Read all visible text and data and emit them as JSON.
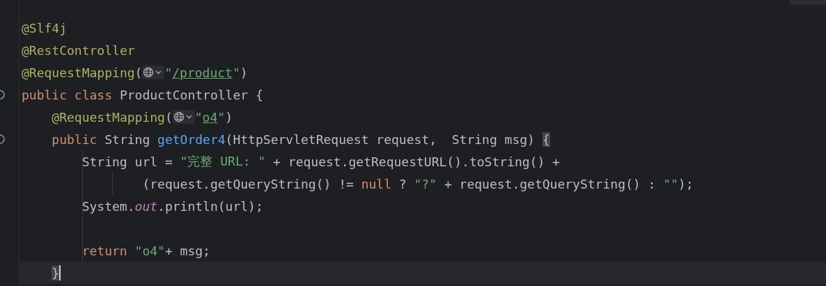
{
  "lines": [
    {
      "tokens": [
        {
          "kind": "annotation",
          "text": "@Slf4j"
        }
      ]
    },
    {
      "tokens": [
        {
          "kind": "annotation",
          "text": "@RestController"
        }
      ]
    },
    {
      "tokens": [
        {
          "kind": "annotation",
          "text": "@RequestMapping"
        },
        {
          "kind": "plain",
          "text": "("
        },
        {
          "kind": "inlay"
        },
        {
          "kind": "string",
          "text": "\""
        },
        {
          "kind": "url",
          "text": "/product"
        },
        {
          "kind": "string",
          "text": "\""
        },
        {
          "kind": "plain",
          "text": ")"
        }
      ]
    },
    {
      "kind": "run",
      "tokens": [
        {
          "kind": "keyword",
          "text": "public class "
        },
        {
          "kind": "plain",
          "text": "ProductController {"
        }
      ],
      "children": [
        {
          "tokens": [
            {
              "kind": "annotation",
              "text": "@RequestMapping"
            },
            {
              "kind": "plain",
              "text": "("
            },
            {
              "kind": "inlay"
            },
            {
              "kind": "string",
              "text": "\""
            },
            {
              "kind": "url",
              "text": "o4"
            },
            {
              "kind": "string",
              "text": "\""
            },
            {
              "kind": "plain",
              "text": ")"
            }
          ]
        },
        {
          "kind": "method",
          "tokens": [
            {
              "kind": "keyword",
              "text": "public "
            },
            {
              "kind": "plain",
              "text": "String "
            },
            {
              "kind": "method",
              "text": "getOrder4"
            },
            {
              "kind": "plain",
              "text": "(HttpServletRequest request,  String msg) "
            },
            {
              "kind": "brace",
              "text": "{"
            }
          ],
          "children": [
            {
              "tokens": [
                {
                  "kind": "plain",
                  "text": "String url = "
                },
                {
                  "kind": "string",
                  "text": "\"完整 URL: \""
                },
                {
                  "kind": "plain",
                  "text": " + request.getRequestURL().toString() +"
                }
              ],
              "children": [
                {
                  "tokens": [
                    {
                      "kind": "plain",
                      "text": "    (request.getQueryString() != "
                    },
                    {
                      "kind": "keyword",
                      "text": "null"
                    },
                    {
                      "kind": "plain",
                      "text": " ? "
                    },
                    {
                      "kind": "string",
                      "text": "\"?\""
                    },
                    {
                      "kind": "plain",
                      "text": " + request.getQueryString() : "
                    },
                    {
                      "kind": "string",
                      "text": "\"\""
                    },
                    {
                      "kind": "plain",
                      "text": ");"
                    }
                  ]
                }
              ]
            },
            {
              "tokens": [
                {
                  "kind": "plain",
                  "text": "System."
                },
                {
                  "kind": "field",
                  "text": "out"
                },
                {
                  "kind": "plain",
                  "text": ".println(url);"
                }
              ]
            },
            {
              "kind": "blank"
            },
            {
              "tokens": [
                {
                  "kind": "keyword",
                  "text": "return "
                },
                {
                  "kind": "string",
                  "text": "\"o4\""
                },
                {
                  "kind": "plain",
                  "text": "+ msg;"
                }
              ]
            }
          ]
        },
        {
          "current": true,
          "tokens": [
            {
              "kind": "brace",
              "text": "}"
            }
          ]
        }
      ]
    }
  ]
}
